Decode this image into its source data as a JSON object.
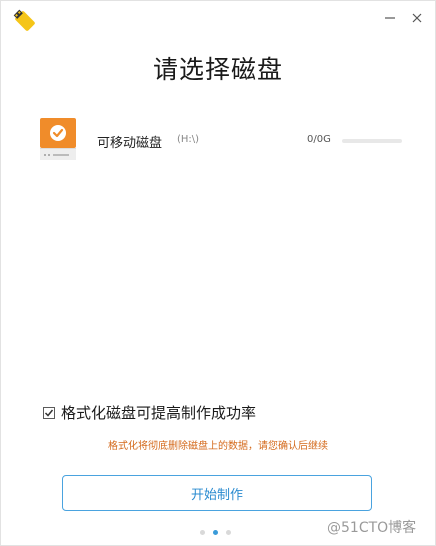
{
  "window": {
    "logo": "app-logo-icon",
    "minimize_icon": "minimize-icon",
    "close_icon": "close-icon"
  },
  "page": {
    "title": "请选择磁盘"
  },
  "disk": {
    "icon": "usb-disk-icon",
    "name": "可移动磁盘",
    "drive": "(H:\\)",
    "size": "0/0G",
    "usage_fraction": 0
  },
  "options": {
    "format_label": "格式化磁盘可提高制作成功率",
    "format_checked": true,
    "warning": "格式化将彻底删除磁盘上的数据，请您确认后继续"
  },
  "actions": {
    "start_label": "开始制作"
  },
  "pager": {
    "count": 3,
    "active_index": 1
  },
  "watermark": "@51CTO博客",
  "colors": {
    "accent": "#3a9bd9",
    "disk_orange": "#f08c2a",
    "warning": "#d46a1c",
    "logo_yellow": "#f5c518"
  }
}
